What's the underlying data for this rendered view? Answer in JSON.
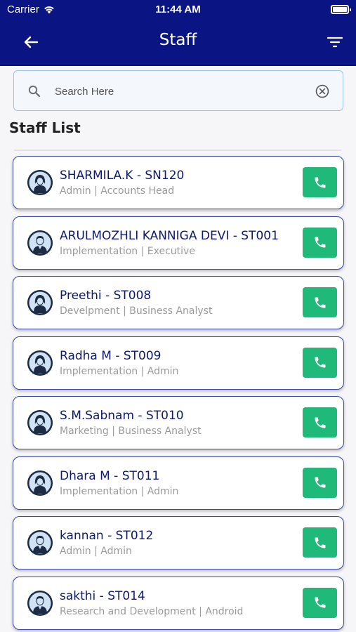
{
  "status_bar": {
    "carrier": "Carrier",
    "time": "11:44 AM"
  },
  "header": {
    "title": "Staff"
  },
  "search": {
    "placeholder": "Search Here",
    "value": ""
  },
  "list_title": "Staff List",
  "staff": [
    {
      "name": "SHARMILA.K - SN120",
      "subtitle": "Admin | Accounts Head",
      "avatar": "female"
    },
    {
      "name": "ARULMOZHLI KANNIGA DEVI - ST001",
      "subtitle": "Implementation | Executive",
      "avatar": "male"
    },
    {
      "name": "Preethi - ST008",
      "subtitle": "Develpment | Business Analyst",
      "avatar": "female"
    },
    {
      "name": "Radha M - ST009",
      "subtitle": "Implementation | Admin",
      "avatar": "female"
    },
    {
      "name": "S.M.Sabnam - ST010",
      "subtitle": "Marketing | Business Analyst",
      "avatar": "female"
    },
    {
      "name": "Dhara M - ST011",
      "subtitle": "Implementation | Admin",
      "avatar": "female"
    },
    {
      "name": "kannan - ST012",
      "subtitle": "Admin | Admin",
      "avatar": "male"
    },
    {
      "name": "sakthi - ST014",
      "subtitle": "Research and Development  | Android",
      "avatar": "male"
    }
  ],
  "colors": {
    "header_bg": "#0a1483",
    "call_button": "#1fb97a",
    "name_text": "#0d1a6e",
    "card_border": "#3b4aa8"
  },
  "icons": {
    "back": "arrow-left-icon",
    "filter": "filter-icon",
    "search": "search-icon",
    "clear": "clear-circle-icon",
    "call": "phone-icon"
  }
}
